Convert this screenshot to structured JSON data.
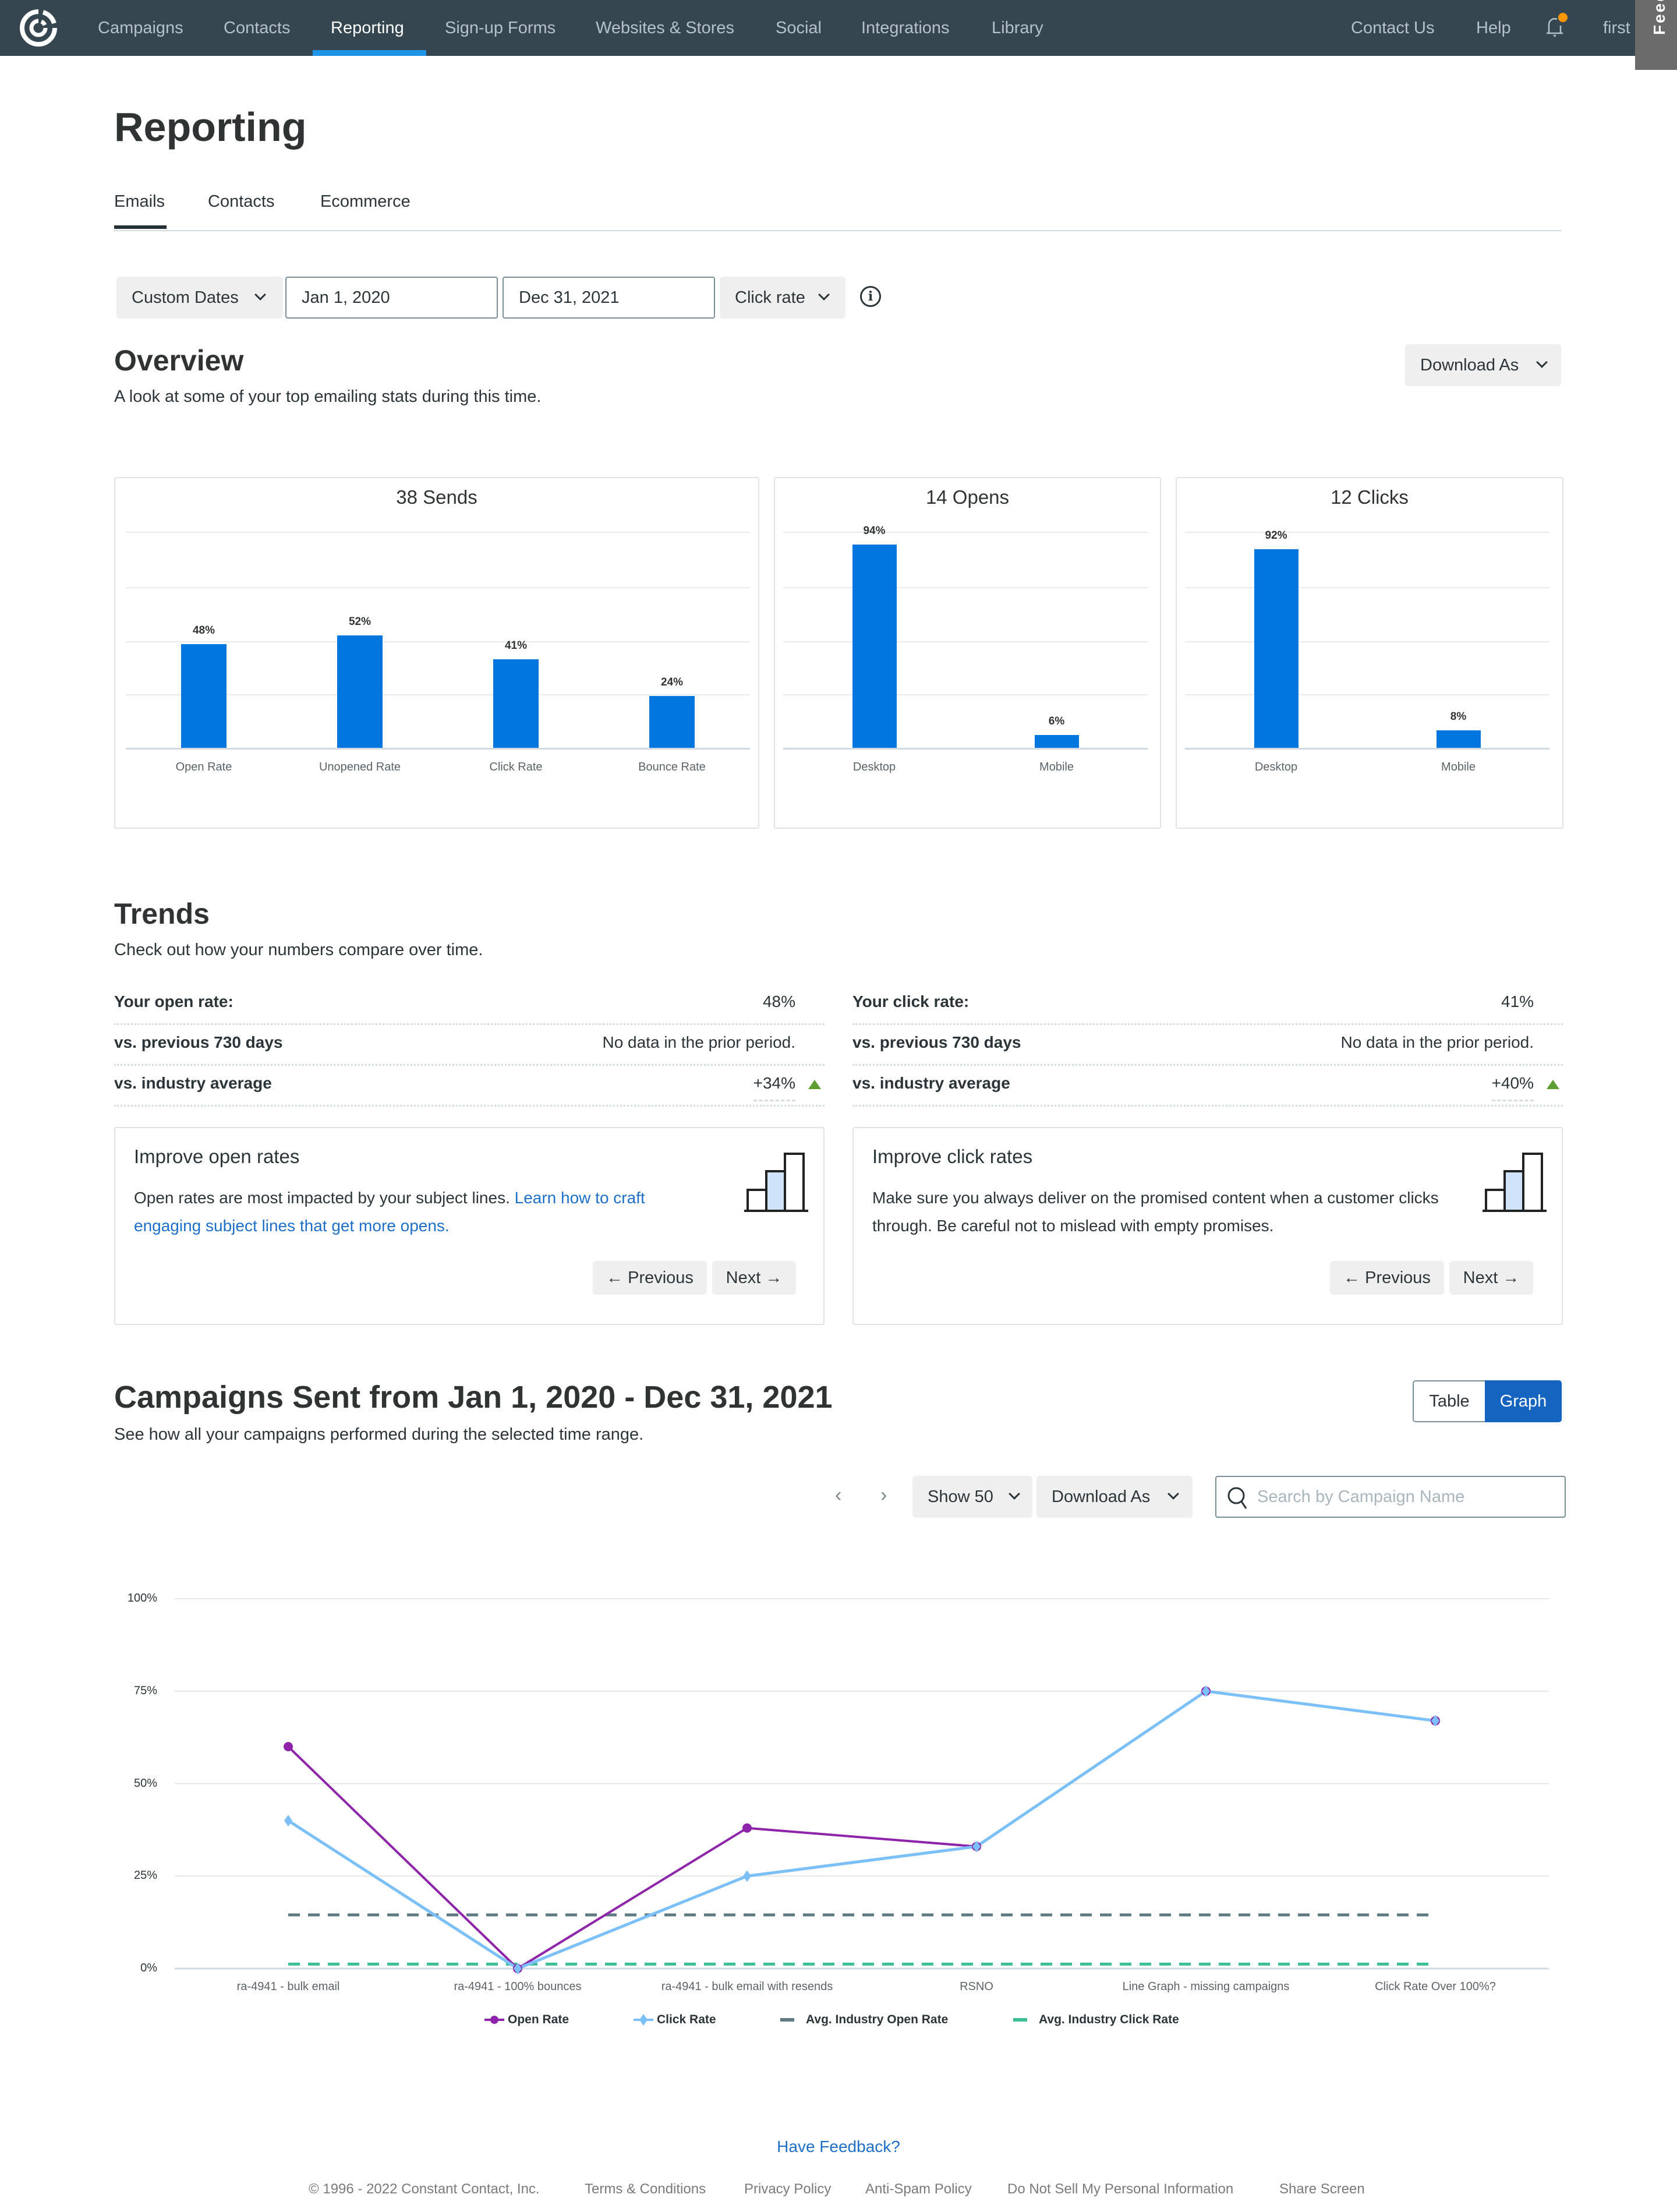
{
  "topnav": {
    "logo": "constant-contact-logo",
    "items": [
      "Campaigns",
      "Contacts",
      "Reporting",
      "Sign-up Forms",
      "Websites & Stores",
      "Social",
      "Integrations",
      "Library"
    ],
    "active": "Reporting",
    "right": {
      "contact_us": "Contact Us",
      "help": "Help",
      "user": "first"
    },
    "feedback_tab": "Feedback"
  },
  "page": {
    "title": "Reporting",
    "tabs": [
      "Emails",
      "Contacts",
      "Ecommerce"
    ],
    "active_tab": "Emails"
  },
  "filters": {
    "range_select": "Custom Dates",
    "start_date": "Jan 1, 2020",
    "end_date": "Dec 31, 2021",
    "metric_select": "Click rate"
  },
  "overview": {
    "title": "Overview",
    "subtitle": "A look at some of your top emailing stats during this time.",
    "download_label": "Download As"
  },
  "chart_data": [
    {
      "type": "bar",
      "title": "38 Sends",
      "categories": [
        "Open Rate",
        "Unopened Rate",
        "Click Rate",
        "Bounce Rate"
      ],
      "values": [
        48,
        52,
        41,
        24
      ],
      "value_labels": [
        "48%",
        "52%",
        "41%",
        "24%"
      ],
      "ylim": [
        0,
        100
      ]
    },
    {
      "type": "bar",
      "title": "14 Opens",
      "categories": [
        "Desktop",
        "Mobile"
      ],
      "values": [
        94,
        6
      ],
      "value_labels": [
        "94%",
        "6%"
      ],
      "ylim": [
        0,
        100
      ]
    },
    {
      "type": "bar",
      "title": "12 Clicks",
      "categories": [
        "Desktop",
        "Mobile"
      ],
      "values": [
        92,
        8
      ],
      "value_labels": [
        "92%",
        "8%"
      ],
      "ylim": [
        0,
        100
      ]
    },
    {
      "type": "line",
      "title": "",
      "x": [
        "ra-4941 - bulk email",
        "ra-4941 - 100% bounces",
        "ra-4941 - bulk email with resends",
        "RSNO",
        "Line Graph - missing campaigns",
        "Click Rate Over 100%?"
      ],
      "yticks": [
        "0%",
        "25%",
        "50%",
        "75%",
        "100%"
      ],
      "ylim": [
        0,
        100
      ],
      "grid": true,
      "legend": "bottom",
      "series": [
        {
          "name": "Open Rate",
          "color": "#8e24aa",
          "style": "solid",
          "values": [
            60,
            0,
            38,
            33,
            75,
            67
          ]
        },
        {
          "name": "Click Rate",
          "color": "#7cc0fa",
          "style": "solid",
          "values": [
            40,
            0,
            25,
            33,
            75,
            67
          ]
        },
        {
          "name": "Avg. Industry Open Rate",
          "color": "#5f7a85",
          "style": "dashed",
          "values": [
            14.5,
            14.5,
            14.5,
            14.5,
            14.5,
            14.5
          ]
        },
        {
          "name": "Avg. Industry Click Rate",
          "color": "#3dbf96",
          "style": "dashed",
          "values": [
            1.2,
            1.2,
            1.2,
            1.2,
            1.2,
            1.2
          ]
        }
      ]
    }
  ],
  "trends": {
    "title": "Trends",
    "subtitle": "Check out how your numbers compare over time.",
    "open": {
      "rows": [
        {
          "label": "Your open rate:",
          "value": "48%"
        },
        {
          "label": "vs. previous 730 days",
          "value": "No data in the prior period."
        },
        {
          "label": "vs. industry average",
          "value": "+34%",
          "trend": "up"
        }
      ],
      "tip": {
        "title": "Improve open rates",
        "body": "Open rates are most impacted by your subject lines. ",
        "link": "Learn how to craft engaging subject lines that get more opens.",
        "prev": "← Previous",
        "next": "Next →"
      }
    },
    "click": {
      "rows": [
        {
          "label": "Your click rate:",
          "value": "41%"
        },
        {
          "label": "vs. previous 730 days",
          "value": "No data in the prior period."
        },
        {
          "label": "vs. industry average",
          "value": "+40%",
          "trend": "up"
        }
      ],
      "tip": {
        "title": "Improve click rates",
        "body": "Make sure you always deliver on the promised content when a customer clicks through. Be careful not to mislead with empty promises.",
        "prev": "← Previous",
        "next": "Next →"
      }
    }
  },
  "campaigns": {
    "title": "Campaigns Sent from Jan 1, 2020 - Dec 31, 2021",
    "subtitle": "See how all your campaigns performed during the selected time range.",
    "view_toggle": {
      "table": "Table",
      "graph": "Graph",
      "active": "Graph"
    },
    "show": "Show 50",
    "download_label": "Download As",
    "search_placeholder": "Search by Campaign Name"
  },
  "footer": {
    "feedback": "Have Feedback?",
    "links": [
      "© 1996 - 2022 Constant Contact, Inc.",
      "Terms & Conditions",
      "Privacy Policy",
      "Anti-Spam Policy",
      "Do Not Sell My Personal Information",
      "Share Screen"
    ]
  },
  "colors": {
    "nav_bg": "#364650",
    "nav_active_underline": "#1f95e8",
    "bar": "#0076de",
    "link": "#1e6fc7",
    "trend_up": "#5c9e32",
    "toggle_active": "#1565c0"
  }
}
